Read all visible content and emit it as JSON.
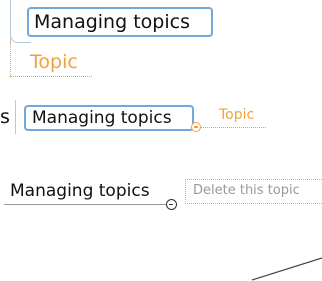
{
  "fragments": {
    "top": {
      "main_topic_label": "Managing topics",
      "subtopic_label": "Topic"
    },
    "middle": {
      "left_partial_text": "s",
      "main_topic_label": "Managing topics",
      "subtopic_label": "Topic"
    },
    "lower": {
      "main_topic_label": "Managing topics",
      "edit_placeholder": "Delete this topic"
    }
  },
  "colors": {
    "accent_blue": "#6fa8dc",
    "subtopic_orange": "#f2a23c",
    "connector_gray": "#b7c8d8",
    "placeholder_gray": "#9a9a9a"
  }
}
